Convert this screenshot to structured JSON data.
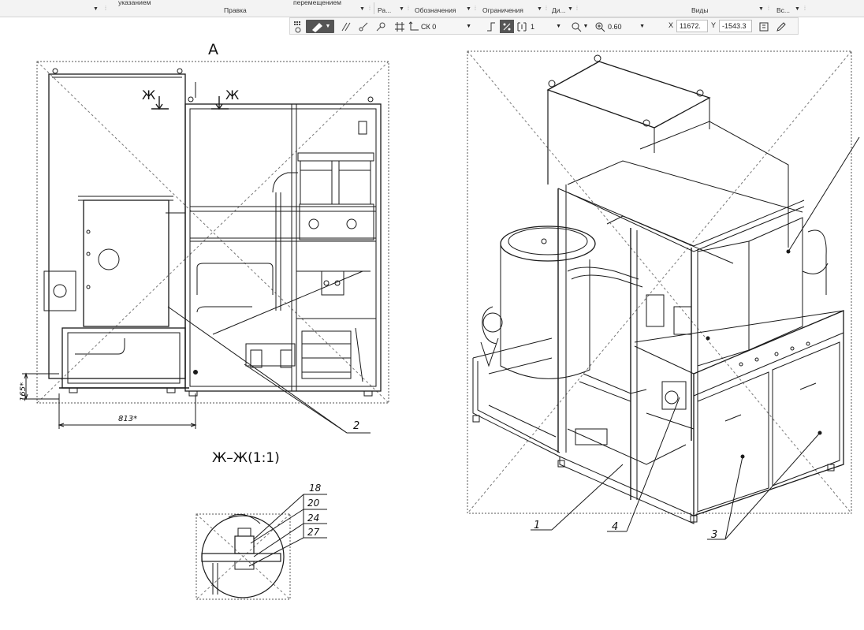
{
  "ribbon": {
    "left_partial": "указанием",
    "group_edit": "Правка",
    "right_partial": "перемещением",
    "group_ra": "Ра...",
    "group_designations": "Обозначения",
    "group_constraints": "Ограничения",
    "group_di": "Ди...",
    "group_views": "Виды",
    "group_all": "Вс..."
  },
  "toolbar": {
    "cs_value": "СК 0",
    "layer_value": "1",
    "zoom_value": "0.60",
    "x_label": "X",
    "x_value": "11672.",
    "y_label": "Y",
    "y_value": "-1543.3"
  },
  "drawing": {
    "view_a_label": "А",
    "section_mark_left": "Ж",
    "section_mark_right": "Ж",
    "dim_height": "165*",
    "dim_width": "813*",
    "section_title": "Ж–Ж(1:1)",
    "callouts_detail": [
      "18",
      "20",
      "24",
      "27"
    ],
    "callout_2": "2",
    "callout_1": "1",
    "callout_4": "4",
    "callout_3": "3"
  },
  "colors": {
    "ribbon_bg": "#f3f3f3",
    "toolbar_active": "#555555",
    "line": "#1a1a1a"
  }
}
